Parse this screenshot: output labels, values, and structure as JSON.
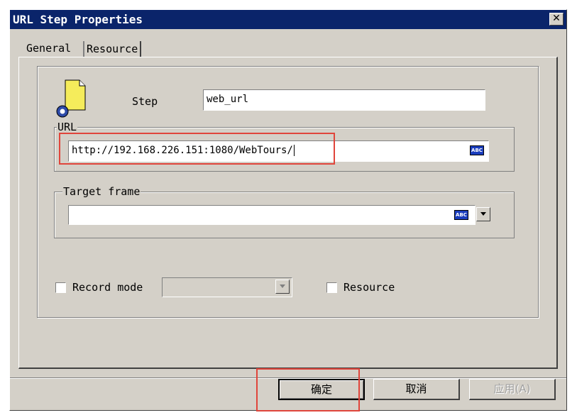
{
  "window": {
    "title": "URL Step Properties",
    "close_label": "✕"
  },
  "tabs": [
    {
      "label": "General",
      "active": true
    },
    {
      "label": "Resource",
      "active": false
    }
  ],
  "step": {
    "label": "Step",
    "value": "web_url",
    "icon": "step-document-icon"
  },
  "url": {
    "group_label": "URL",
    "value": "http://192.168.226.151:1080/WebTours/",
    "abc_icon": "ABC"
  },
  "target_frame": {
    "group_label": "Target frame",
    "value": "",
    "abc_icon": "ABC"
  },
  "options": {
    "record_mode_label": "Record mode",
    "record_mode_checked": false,
    "record_mode_value": "",
    "resource_label": "Resource",
    "resource_checked": false
  },
  "buttons": {
    "ok": "确定",
    "cancel": "取消",
    "apply": "应用(A)"
  },
  "colors": {
    "titlebar": "#0a246a",
    "dialog": "#d4d0c8",
    "highlight": "#e0453b"
  }
}
